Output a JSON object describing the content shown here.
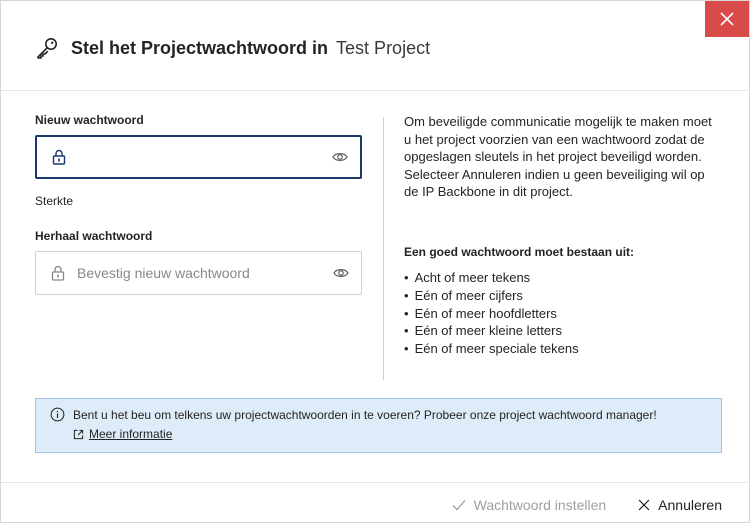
{
  "dialog": {
    "title": "Stel het Projectwachtwoord in",
    "project_name": "Test Project",
    "close_label": "×"
  },
  "form": {
    "new_password_label": "Nieuw wachtwoord",
    "new_password_value": "",
    "new_password_placeholder": "",
    "strength_label": "Sterkte",
    "repeat_password_label": "Herhaal wachtwoord",
    "repeat_password_placeholder": "Bevestig nieuw wachtwoord"
  },
  "help": {
    "description": "Om beveiligde communicatie mogelijk te maken moet u het project voorzien van een wachtwoord zodat de opgeslagen sleutels in het project beveiligd worden. Selecteer Annuleren indien u geen beveiliging wil op de IP Backbone in dit project.",
    "requirements_title": "Een goed wachtwoord moet bestaan uit:",
    "requirements": [
      "Acht of meer tekens",
      "Eén of meer cijfers",
      "Eén of meer hoofdletters",
      "Eén of meer kleine letters",
      "Eén of meer speciale tekens"
    ]
  },
  "info": {
    "message": "Bent u het beu om telkens uw projectwachtwoorden in te voeren? Probeer onze project wachtwoord manager!",
    "link_text": "Meer informatie"
  },
  "footer": {
    "set_password_label": "Wachtwoord instellen",
    "cancel_label": "Annuleren"
  },
  "colors": {
    "close_bg": "#d94a4a",
    "active_border": "#1b3a6b",
    "info_bg": "#deecf9",
    "info_border": "#9fc3e6",
    "disabled_text": "#a19f9d"
  }
}
